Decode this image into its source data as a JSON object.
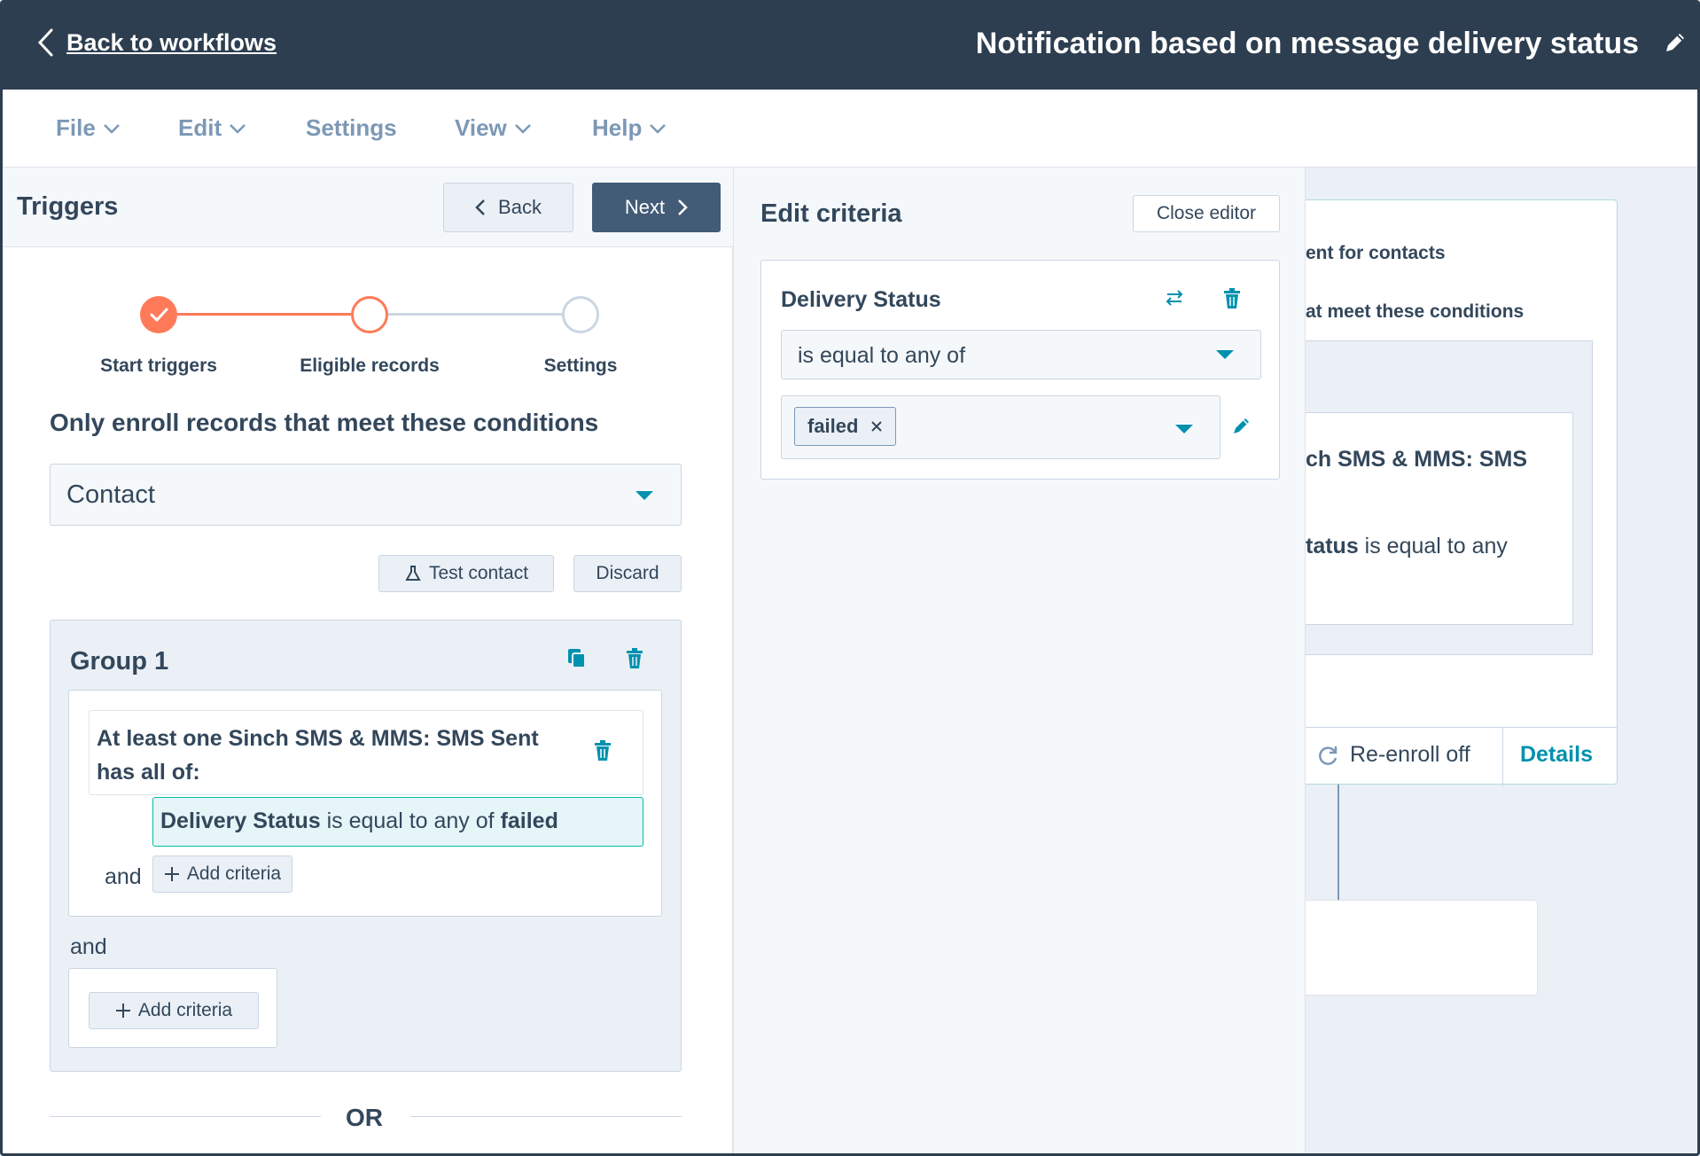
{
  "topbar": {
    "back_label": "Back to workflows",
    "workflow_title": "Notification based on message delivery status"
  },
  "menu": {
    "items": [
      {
        "label": "File"
      },
      {
        "label": "Edit"
      },
      {
        "label": "Settings"
      },
      {
        "label": "View"
      },
      {
        "label": "Help"
      }
    ]
  },
  "left_panel": {
    "title": "Triggers",
    "back_label": "Back",
    "next_label": "Next",
    "steps": [
      {
        "label": "Start triggers",
        "state": "complete"
      },
      {
        "label": "Eligible records",
        "state": "current"
      },
      {
        "label": "Settings",
        "state": "upcoming"
      }
    ],
    "enroll_heading": "Only enroll records that meet these conditions",
    "object_select": "Contact",
    "test_contact_label": "Test contact",
    "discard_label": "Discard",
    "group": {
      "title": "Group 1",
      "object_condition": "At least one Sinch SMS & MMS: SMS Sent has all of:",
      "criterion": {
        "property": "Delivery Status",
        "operator": "is equal to any of",
        "value": "failed"
      },
      "and_label": "and",
      "add_criteria_label": "Add criteria"
    },
    "outer_and_label": "and",
    "outer_add_criteria_label": "Add criteria",
    "or_label": "OR"
  },
  "editor": {
    "title": "Edit criteria",
    "close_label": "Close editor",
    "property_name": "Delivery Status",
    "operator": "is equal to any of",
    "selected_value": "failed"
  },
  "canvas": {
    "line1": "ent for contacts",
    "line2": "at meet these conditions",
    "line3": "ch SMS & MMS: SMS",
    "line4_bold": "tatus",
    "line4_rest": " is equal to any",
    "reenroll_label": "Re-enroll off",
    "details_label": "Details"
  },
  "colors": {
    "topbar": "#2d3e50",
    "accent_teal": "#0091ae",
    "step_complete": "#ff7a59",
    "primary_button": "#425b76"
  }
}
